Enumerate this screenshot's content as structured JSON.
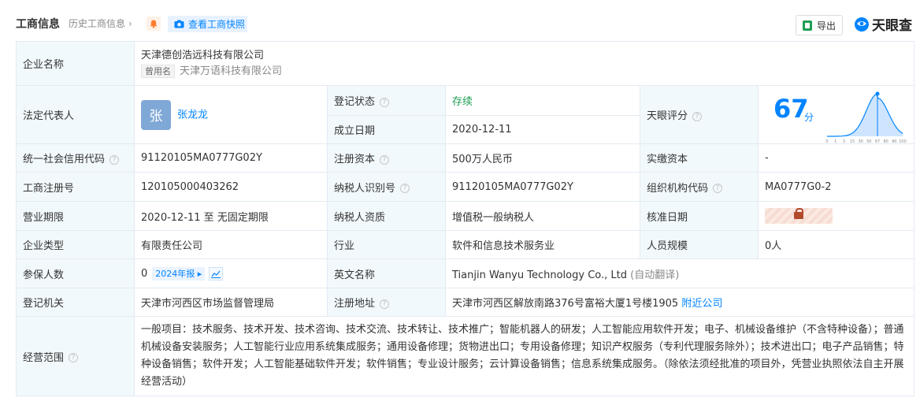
{
  "header": {
    "title": "工商信息",
    "history": "历史工商信息",
    "snapshot_button": "查看工商快照",
    "export_button": "导出",
    "brand": "天眼查"
  },
  "rows": {
    "company_name": {
      "label": "企业名称",
      "value": "天津德创浩远科技有限公司",
      "alias_tag": "曾用名",
      "alias": "天津万语科技有限公司"
    },
    "legal_rep": {
      "label": "法定代表人",
      "avatar": "张",
      "name": "张龙龙"
    },
    "reg_status": {
      "label": "登记状态",
      "value": "存续"
    },
    "established": {
      "label": "成立日期",
      "value": "2020-12-11"
    },
    "score": {
      "label": "天眼评分",
      "value": "67",
      "unit": "分"
    },
    "credit_code": {
      "label": "统一社会信用代码",
      "value": "91120105MA0777G02Y"
    },
    "reg_capital": {
      "label": "注册资本",
      "value": "500万人民币"
    },
    "paid_capital": {
      "label": "实缴资本",
      "value": "-"
    },
    "biz_reg_no": {
      "label": "工商注册号",
      "value": "120105000403262"
    },
    "taxpayer_id": {
      "label": "纳税人识别号",
      "value": "91120105MA0777G02Y"
    },
    "org_code": {
      "label": "组织机构代码",
      "value": "MA0777G0-2"
    },
    "term": {
      "label": "营业期限",
      "value": "2020-12-11 至 无固定期限"
    },
    "taxpayer_qual": {
      "label": "纳税人资质",
      "value": "增值税一般纳税人"
    },
    "approval_date": {
      "label": "核准日期"
    },
    "company_type": {
      "label": "企业类型",
      "value": "有限责任公司"
    },
    "industry": {
      "label": "行业",
      "value": "软件和信息技术服务业"
    },
    "staff_size": {
      "label": "人员规模",
      "value": "0人"
    },
    "insured": {
      "label": "参保人数",
      "value": "0",
      "report_tag": "2024年报"
    },
    "english_name": {
      "label": "英文名称",
      "value": "Tianjin Wanyu Technology Co., Ltd",
      "note": "(自动翻译)"
    },
    "reg_authority": {
      "label": "登记机关",
      "value": "天津市河西区市场监督管理局"
    },
    "reg_address": {
      "label": "注册地址",
      "value": "天津市河西区解放南路376号富裕大厦1号楼1905",
      "link": "附近公司"
    },
    "scope": {
      "label": "经营范围",
      "value": "一般项目：技术服务、技术开发、技术咨询、技术交流、技术转让、技术推广；智能机器人的研发；人工智能应用软件开发；电子、机械设备维护（不含特种设备）；普通机械设备安装服务；人工智能行业应用系统集成服务；通用设备修理；货物进出口；专用设备修理；知识产权服务（专利代理服务除外）；技术进出口；电子产品销售；特种设备销售；软件开发；人工智能基础软件开发；软件销售；专业设计服务；云计算设备销售；信息系统集成服务。（除依法须经批准的项目外，凭营业执照依法自主开展经营活动）"
    }
  },
  "score_chart": {
    "x_ticks": [
      "0",
      "1",
      "3",
      "15",
      "30",
      "50",
      "67",
      "80",
      "90",
      "100"
    ],
    "marker_value": 67,
    "accent": "#0084ff"
  }
}
